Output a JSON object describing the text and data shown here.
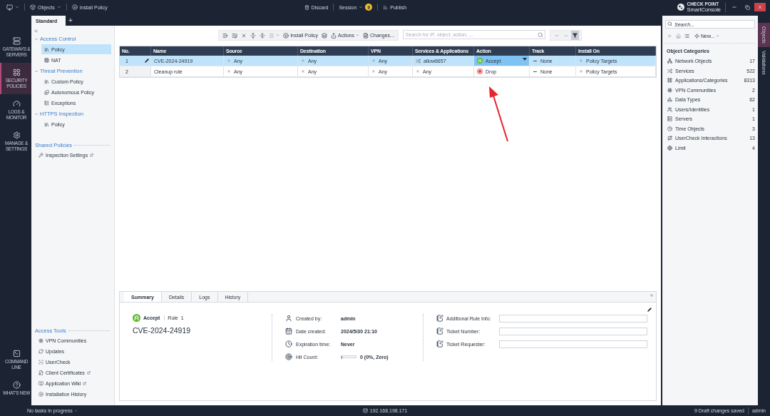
{
  "top_bar": {
    "menu": [
      {
        "label": "Objects",
        "dropdown": true
      },
      {
        "label": "Install Policy",
        "dropdown": false
      }
    ],
    "session": [
      {
        "label": "Discard",
        "dropdown": false
      },
      {
        "label": "Session",
        "dropdown": true
      },
      {
        "label": "Publish",
        "dropdown": false
      }
    ],
    "session_badge": "9",
    "brand": {
      "company": "CHECK POINT",
      "product": "SmartConsole"
    }
  },
  "policy_tabs": [
    {
      "label": "Standard",
      "selected": true
    }
  ],
  "add_tab": "+",
  "rail": {
    "top": [
      {
        "label": "GATEWAYS & SERVERS",
        "selected": false
      },
      {
        "label": "SECURITY POLICIES",
        "selected": true
      },
      {
        "label": "LOGS & MONITOR",
        "selected": false
      },
      {
        "label": "MANAGE & SETTINGS",
        "selected": false
      }
    ],
    "bottom": [
      {
        "label": "COMMAND LINE",
        "selected": false
      },
      {
        "label": "WHAT'S NEW",
        "selected": false
      }
    ]
  },
  "tree": {
    "sections": [
      {
        "title": "Access Control",
        "expanded": true,
        "items": [
          {
            "label": "Policy",
            "selected": true
          },
          {
            "label": "NAT",
            "selected": false
          }
        ]
      },
      {
        "title": "Threat Prevention",
        "expanded": true,
        "items": [
          {
            "label": "Custom Policy",
            "selected": false
          },
          {
            "label": "Autonomous Policy",
            "selected": false
          },
          {
            "label": "Exceptions",
            "selected": false
          }
        ]
      },
      {
        "title": "HTTPS Inspection",
        "expanded": true,
        "items": [
          {
            "label": "Policy",
            "selected": false
          }
        ]
      }
    ],
    "shared": {
      "title": "Shared Policies",
      "items": [
        {
          "label": "Inspection Settings",
          "external": true
        }
      ]
    },
    "access_tools": {
      "title": "Access Tools",
      "items": [
        {
          "label": "VPN Communities",
          "external": false
        },
        {
          "label": "Updates",
          "external": false
        },
        {
          "label": "UserCheck",
          "external": false
        },
        {
          "label": "Client Certificates",
          "external": true
        },
        {
          "label": "Application Wiki",
          "external": true
        },
        {
          "label": "Installation History",
          "external": false
        }
      ]
    }
  },
  "toolbar": {
    "install_button": "Install Policy",
    "actions_button": "Actions",
    "changes_button": "Changes...",
    "search_placeholder": "Search for IP, object, action, ..."
  },
  "table": {
    "columns": [
      "No.",
      "Name",
      "Source",
      "Destination",
      "VPN",
      "Services & Applications",
      "Action",
      "Track",
      "Install On"
    ],
    "rows": [
      {
        "selected": true,
        "cells": [
          {
            "text": "1",
            "kind": "number"
          },
          {
            "text": "CVE-2024-24919",
            "kind": "plain"
          },
          {
            "text": "Any",
            "kind": "any"
          },
          {
            "text": "Any",
            "kind": "any"
          },
          {
            "text": "Any",
            "kind": "any"
          },
          {
            "text": "allow6657",
            "kind": "service"
          },
          {
            "text": "Accept",
            "kind": "accept"
          },
          {
            "text": "None",
            "kind": "none"
          },
          {
            "text": "Policy Targets",
            "kind": "any"
          }
        ]
      },
      {
        "selected": false,
        "cells": [
          {
            "text": "2",
            "kind": "number"
          },
          {
            "text": "Cleanup rule",
            "kind": "plain"
          },
          {
            "text": "Any",
            "kind": "any"
          },
          {
            "text": "Any",
            "kind": "any"
          },
          {
            "text": "Any",
            "kind": "any"
          },
          {
            "text": "Any",
            "kind": "any"
          },
          {
            "text": "Drop",
            "kind": "drop"
          },
          {
            "text": "None",
            "kind": "none"
          },
          {
            "text": "Policy Targets",
            "kind": "any"
          }
        ]
      }
    ]
  },
  "details": {
    "tabs": [
      {
        "label": "Summary",
        "selected": true
      },
      {
        "label": "Details",
        "selected": false
      },
      {
        "label": "Logs",
        "selected": false
      },
      {
        "label": "History",
        "selected": false
      }
    ],
    "action": {
      "label": "Accept",
      "kind": "accept"
    },
    "rule_label": "Rule",
    "rule_number": "1",
    "title": "CVE-2024-24919",
    "meta": [
      {
        "label": "Created by:",
        "value": "admin"
      },
      {
        "label": "Date created:",
        "value": "2024/5/30 21:10"
      },
      {
        "label": "Expiration time:",
        "value": "Never"
      },
      {
        "label": "Hit Count:",
        "value": "0 (0%, Zero)",
        "level": 0
      }
    ],
    "fields": [
      {
        "label": "Additional Rule Info:"
      },
      {
        "label": "Ticket Number:"
      },
      {
        "label": "Ticket Requester:"
      }
    ]
  },
  "objects_panel": {
    "search_placeholder": "Search...",
    "new_button": "New...",
    "heading": "Object Categories",
    "categories": [
      {
        "label": "Network Objects",
        "count": "17"
      },
      {
        "label": "Services",
        "count": "522"
      },
      {
        "label": "Applications/Categories",
        "count": "8313"
      },
      {
        "label": "VPN Communities",
        "count": "2"
      },
      {
        "label": "Data Types",
        "count": "62"
      },
      {
        "label": "Users/Identities",
        "count": "1"
      },
      {
        "label": "Servers",
        "count": "1"
      },
      {
        "label": "Time Objects",
        "count": "3"
      },
      {
        "label": "UserCheck Interactions",
        "count": "13"
      },
      {
        "label": "Limit",
        "count": "4"
      }
    ]
  },
  "side_tabs": [
    {
      "label": "Objects",
      "selected": true
    },
    {
      "label": "Validations",
      "selected": false
    }
  ],
  "status_bar": {
    "tasks": "No tasks in progress",
    "server": "192.168.198.171",
    "drafts": "9 Draft changes saved",
    "user": "admin"
  }
}
